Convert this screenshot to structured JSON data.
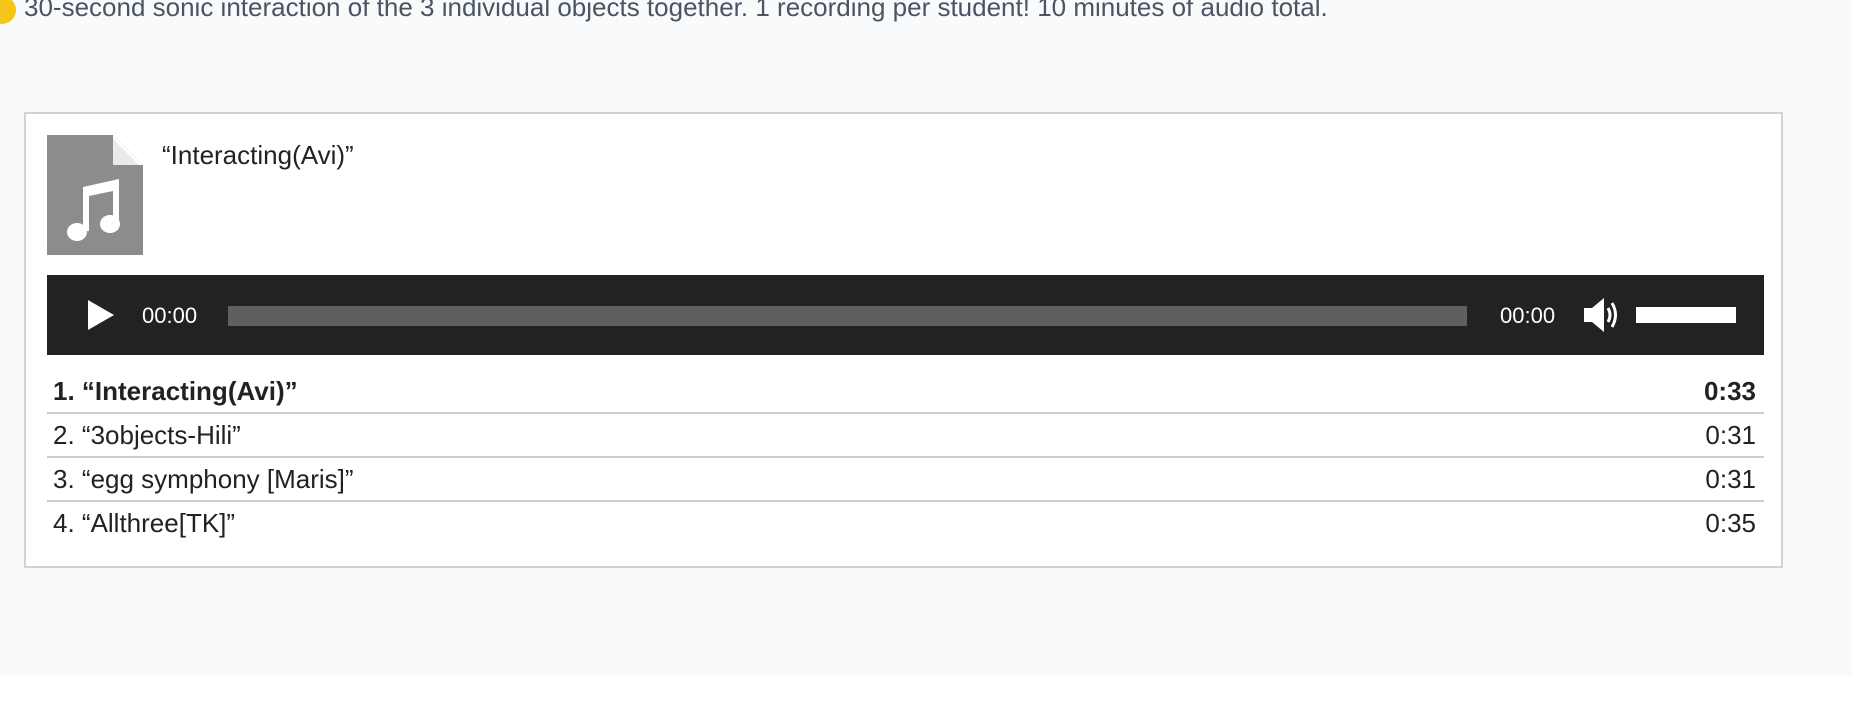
{
  "intro_text": "30-second sonic interaction of the 3 individual objects together. 1 recording per student! 10 minutes of audio total.",
  "playlist": {
    "now_playing_title": "“Interacting(Avi)”",
    "artwork_icon": "music-file-icon",
    "player": {
      "current_time": "00:00",
      "duration": "00:00",
      "progress": 0,
      "volume": 1.0,
      "play_icon": "play-icon",
      "volume_icon": "speaker-volume-icon"
    },
    "tracks": [
      {
        "title": "1. “Interacting(Avi)”",
        "length": "0:33",
        "current": true
      },
      {
        "title": "2. “3objects-Hili”",
        "length": "0:31",
        "current": false
      },
      {
        "title": "3. “egg symphony [Maris]”",
        "length": "0:31",
        "current": false
      },
      {
        "title": "4. “Allthree[TK]”",
        "length": "0:35",
        "current": false
      }
    ]
  },
  "colors": {
    "page_background": "#f9fafb",
    "player_background": "#222222",
    "rail": "#5f5f5f",
    "artwork_gray": "#8c8c8c",
    "accent_dot": "#f5c518"
  }
}
